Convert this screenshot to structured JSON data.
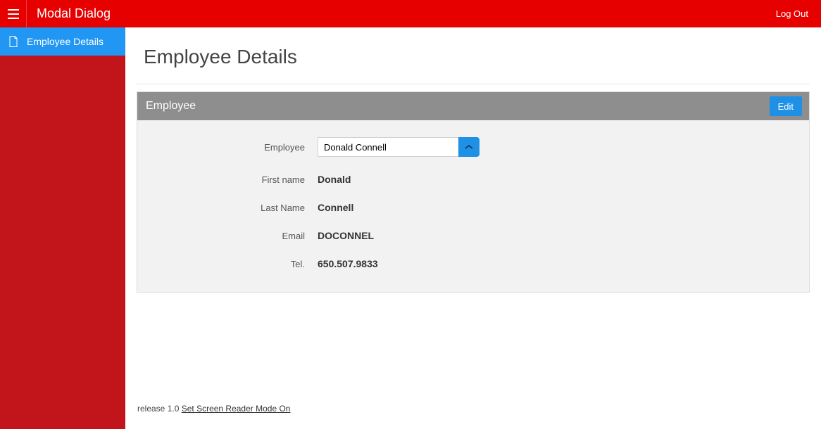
{
  "header": {
    "app_title": "Modal Dialog",
    "logout": "Log Out"
  },
  "sidebar": {
    "items": [
      {
        "label": "Employee Details"
      }
    ]
  },
  "page": {
    "title": "Employee Details"
  },
  "region": {
    "title": "Employee",
    "edit_label": "Edit",
    "fields": {
      "employee_label": "Employee",
      "employee_value": "Donald Connell",
      "first_name_label": "First name",
      "first_name_value": "Donald",
      "last_name_label": "Last Name",
      "last_name_value": "Connell",
      "email_label": "Email",
      "email_value": "DOCONNEL",
      "tel_label": "Tel.",
      "tel_value": "650.507.9833"
    }
  },
  "footer": {
    "release": "release 1.0 ",
    "screen_reader": "Set Screen Reader Mode On"
  }
}
